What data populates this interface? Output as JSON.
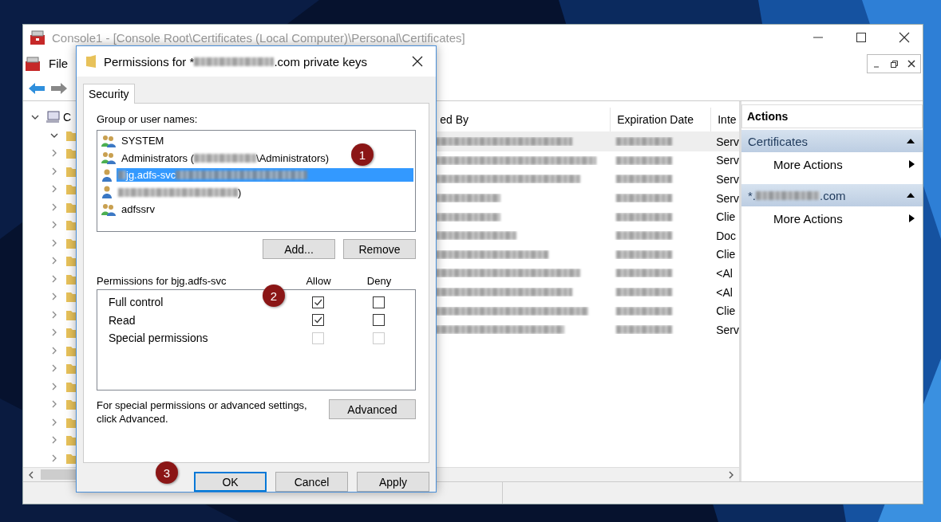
{
  "window": {
    "title": "Console1 - [Console Root\\Certificates (Local Computer)\\Personal\\Certificates]"
  },
  "menu": [
    "File"
  ],
  "tree": {
    "label": "C",
    "expanded": true,
    "children": [
      {
        "expanded": true
      },
      {
        "expanded": false
      },
      {
        "expanded": false
      },
      {
        "expanded": false
      },
      {
        "expanded": false
      },
      {
        "expanded": false
      },
      {
        "expanded": false
      },
      {
        "expanded": false
      },
      {
        "expanded": false
      },
      {
        "expanded": false
      },
      {
        "expanded": false
      },
      {
        "expanded": false
      },
      {
        "expanded": false
      },
      {
        "expanded": false
      },
      {
        "expanded": false
      },
      {
        "expanded": false
      },
      {
        "expanded": false
      },
      {
        "expanded": false
      },
      {
        "expanded": false
      }
    ]
  },
  "list": {
    "columns": [
      "ed By",
      "Expiration Date",
      "Inte"
    ],
    "rows": [
      {
        "selected": true,
        "column_3": "Serv"
      },
      {
        "selected": false,
        "column_3": "Serv"
      },
      {
        "selected": false,
        "column_3": "Serv"
      },
      {
        "selected": false,
        "column_3": "Serv"
      },
      {
        "selected": false,
        "column_3": "Clie"
      },
      {
        "selected": false,
        "column_3": "Doc"
      },
      {
        "selected": false,
        "column_3": "Clie"
      },
      {
        "selected": false,
        "column_3": "<Al"
      },
      {
        "selected": false,
        "column_3": "<Al"
      },
      {
        "selected": false,
        "column_3": "Clie"
      },
      {
        "selected": false,
        "column_3": "Serv"
      }
    ]
  },
  "actions": {
    "title": "Actions",
    "sections": [
      {
        "parts": [
          {
            "text": "Certificates"
          }
        ],
        "expanded": true,
        "items": [
          "More Actions"
        ]
      },
      {
        "parts": [
          {
            "text": "*."
          },
          {
            "kind": "redacted"
          },
          {
            "text": ".com"
          }
        ],
        "expanded": true,
        "items": [
          "More Actions"
        ]
      }
    ]
  },
  "dialog": {
    "title_parts": [
      {
        "text": "Permissions for *"
      },
      {
        "kind": "redacted"
      },
      {
        "text": ".com private keys"
      }
    ],
    "tabs": [
      {
        "label": "Security",
        "selected": true
      }
    ],
    "users_label": "Group or user names:",
    "users": [
      {
        "kind": "group",
        "selected": false,
        "parts": [
          {
            "text": "SYSTEM"
          }
        ]
      },
      {
        "kind": "group",
        "selected": false,
        "parts": [
          {
            "text": "Administrators ("
          },
          {
            "kind": "redacted"
          },
          {
            "text": "\\Administrators)"
          }
        ]
      },
      {
        "kind": "user",
        "selected": true,
        "parts": [
          {
            "kind": "redacted"
          },
          {
            "text": "jg.adfs-svc"
          },
          {
            "kind": "redacted"
          }
        ]
      },
      {
        "kind": "user",
        "selected": false,
        "parts": [
          {
            "kind": "redacted"
          },
          {
            "text": ")"
          }
        ]
      },
      {
        "kind": "group",
        "selected": false,
        "parts": [
          {
            "text": "adfssrv"
          }
        ]
      }
    ],
    "user_buttons": [
      "Add...",
      "Remove"
    ],
    "permissions_label": "Permissions for bjg.adfs-svc",
    "permission_columns": [
      "Allow",
      "Deny"
    ],
    "permissions": [
      {
        "name": "Full control",
        "allow": {
          "checked": true,
          "disabled": false
        },
        "deny": {
          "checked": false,
          "disabled": false
        }
      },
      {
        "name": "Read",
        "allow": {
          "checked": true,
          "disabled": false
        },
        "deny": {
          "checked": false,
          "disabled": false
        }
      },
      {
        "name": "Special permissions",
        "allow": {
          "checked": false,
          "disabled": true
        },
        "deny": {
          "checked": false,
          "disabled": true
        }
      }
    ],
    "advanced_note": "For special permissions or advanced settings, click Advanced.",
    "advanced_button": "Advanced",
    "buttons": [
      {
        "label": "OK",
        "default": true
      },
      {
        "label": "Cancel",
        "default": false
      },
      {
        "label": "Apply",
        "default": false
      }
    ]
  },
  "annotations": [
    "1",
    "2",
    "3"
  ]
}
